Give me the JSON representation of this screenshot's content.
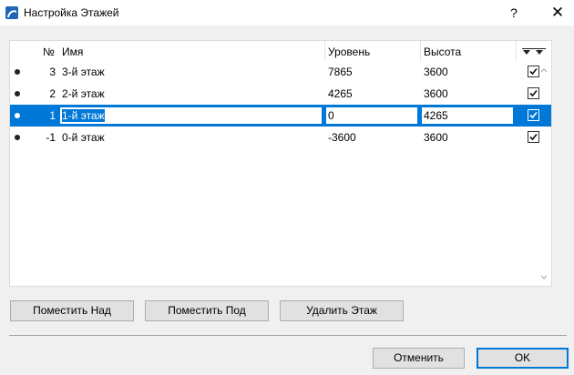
{
  "window": {
    "title": "Настройка Этажей",
    "help_label": "?",
    "close_label": "✕",
    "accent_color": "#0078d7"
  },
  "table": {
    "columns": {
      "number": "№",
      "name": "Имя",
      "level": "Уровень",
      "height": "Высота"
    },
    "rows": [
      {
        "number": "3",
        "name": "3-й этаж",
        "level": "7865",
        "height": "3600",
        "checked": true,
        "selected": false
      },
      {
        "number": "2",
        "name": "2-й этаж",
        "level": "4265",
        "height": "3600",
        "checked": true,
        "selected": false
      },
      {
        "number": "1",
        "name": "1-й этаж",
        "level": "0",
        "height": "4265",
        "checked": true,
        "selected": true
      },
      {
        "number": "-1",
        "name": "0-й этаж",
        "level": "-3600",
        "height": "3600",
        "checked": true,
        "selected": false
      }
    ]
  },
  "buttons": {
    "place_above": "Поместить Над",
    "place_below": "Поместить Под",
    "delete_floor": "Удалить Этаж",
    "cancel": "Отменить",
    "ok": "OK"
  }
}
